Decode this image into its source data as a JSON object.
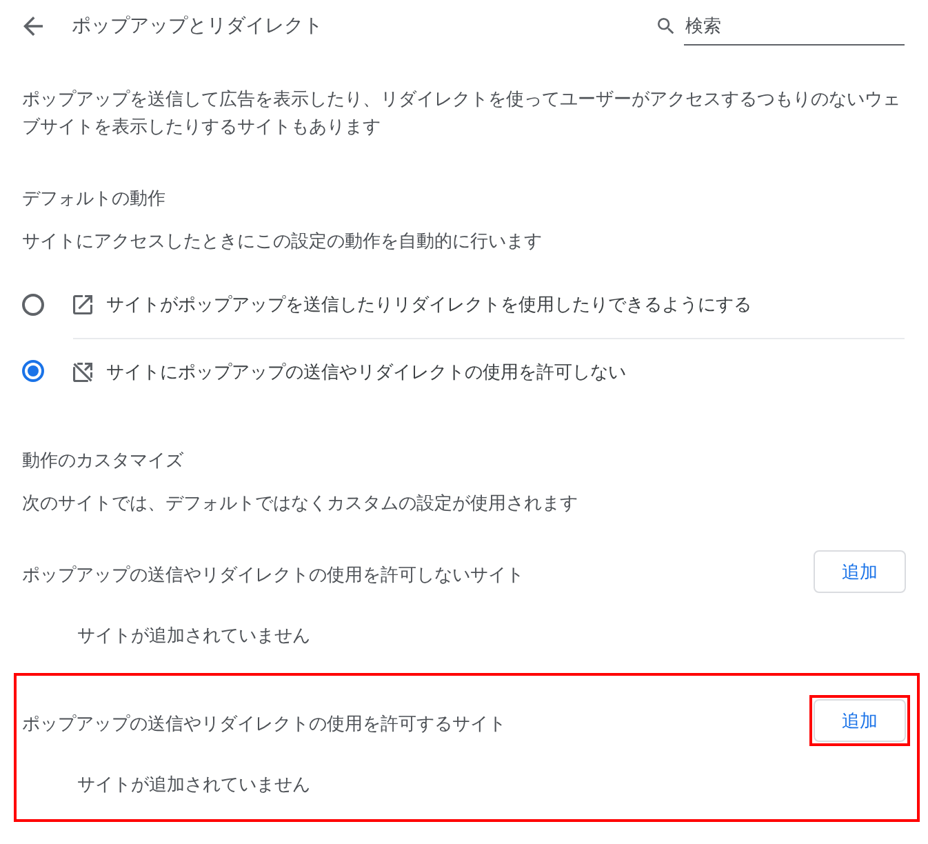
{
  "header": {
    "title": "ポップアップとリダイレクト",
    "search": {
      "placeholder": "検索"
    }
  },
  "description": "ポップアップを送信して広告を表示したり、リダイレクトを使ってユーザーがアクセスするつもりのないウェブサイトを表示したりするサイトもあります",
  "default_behavior": {
    "heading": "デフォルトの動作",
    "subheading": "サイトにアクセスしたときにこの設定の動作を自動的に行います",
    "options": [
      {
        "kind": "allow",
        "label": "サイトがポップアップを送信したりリダイレクトを使用したりできるようにする",
        "selected": false
      },
      {
        "kind": "block",
        "label": "サイトにポップアップの送信やリダイレクトの使用を許可しない",
        "selected": true
      }
    ]
  },
  "customize": {
    "heading": "動作のカスタマイズ",
    "subheading": "次のサイトでは、デフォルトではなくカスタムの設定が使用されます",
    "sections": [
      {
        "title": "ポップアップの送信やリダイレクトの使用を許可しないサイト",
        "button": "追加",
        "empty_text": "サイトが追加されていません",
        "highlighted": false,
        "button_highlighted": false
      },
      {
        "title": "ポップアップの送信やリダイレクトの使用を許可するサイト",
        "button": "追加",
        "empty_text": "サイトが追加されていません",
        "highlighted": true,
        "button_highlighted": true
      }
    ]
  }
}
